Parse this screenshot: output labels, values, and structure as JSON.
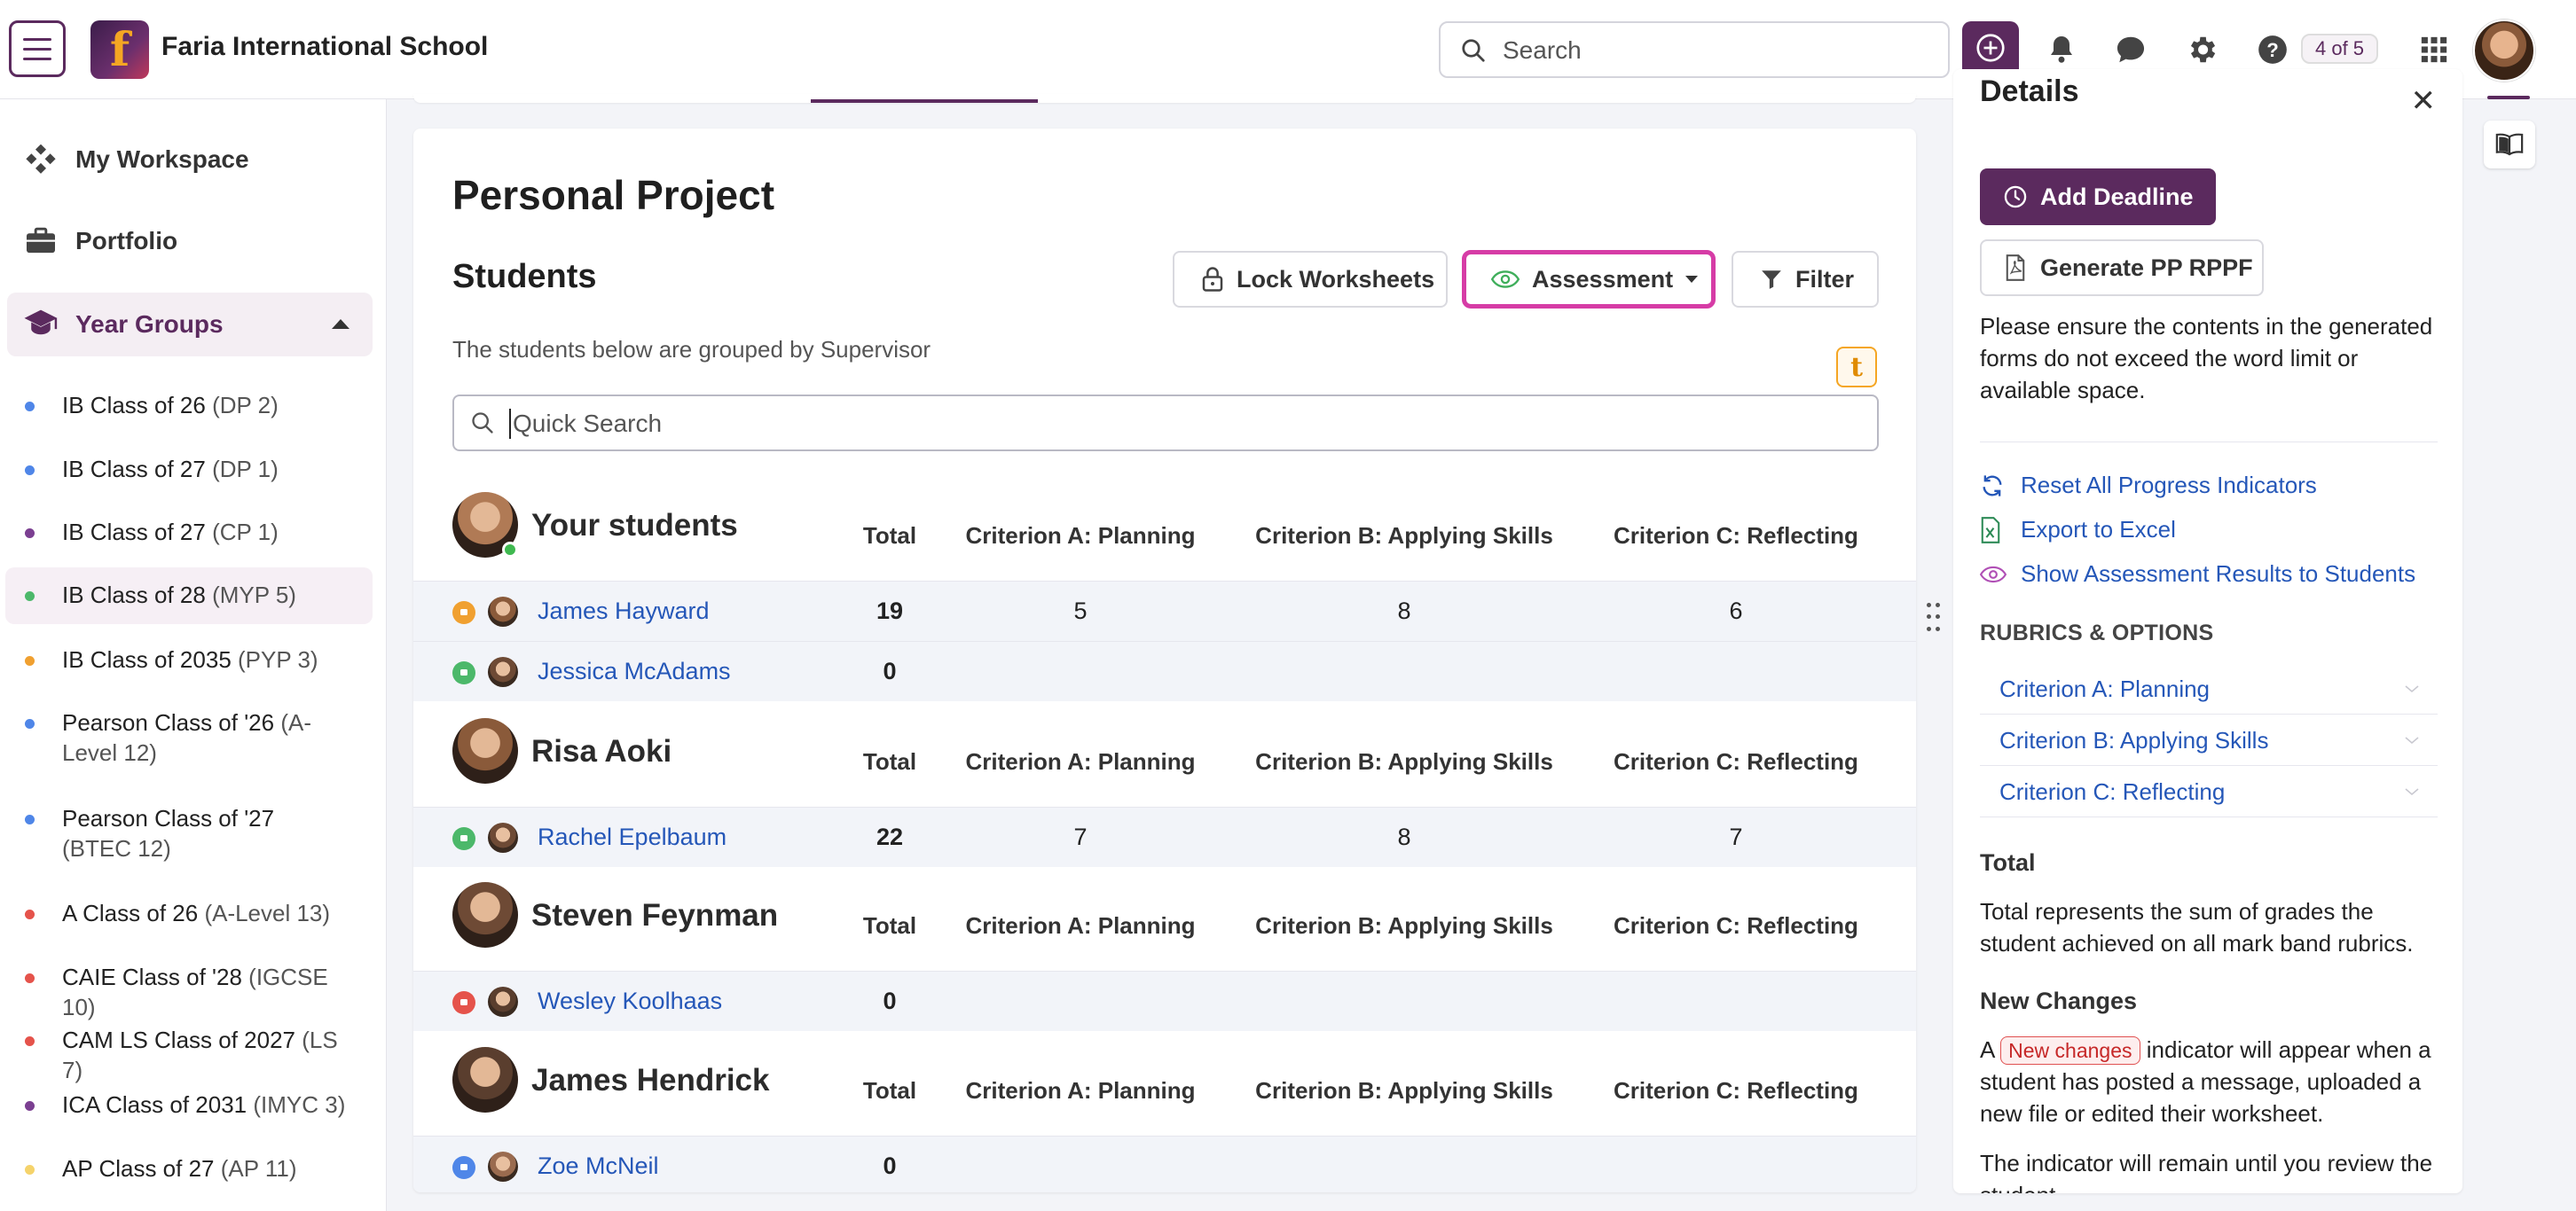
{
  "header": {
    "school_name": "Faria International School",
    "logo_letter": "f",
    "search_placeholder": "Search",
    "pager": "4 of 5",
    "icons": [
      "menu-icon",
      "plus-circle-icon",
      "bell-icon",
      "chat-icon",
      "gear-icon",
      "help-icon",
      "apps-grid-icon"
    ]
  },
  "sidebar": {
    "my_workspace": "My Workspace",
    "portfolio": "Portfolio",
    "year_groups": "Year Groups",
    "classes": [
      {
        "name": "IB Class of 26",
        "abbr": "(DP 2)",
        "color": "#4f86e8",
        "active": false
      },
      {
        "name": "IB Class of 27",
        "abbr": "(DP 1)",
        "color": "#4f86e8",
        "active": false
      },
      {
        "name": "IB Class of 27",
        "abbr": "(CP 1)",
        "color": "#7b3f91",
        "active": false
      },
      {
        "name": "IB Class of 28",
        "abbr": "(MYP 5)",
        "color": "#4cb86a",
        "active": true
      },
      {
        "name": "IB Class of 2035",
        "abbr": "(PYP 3)",
        "color": "#f0a030",
        "active": false
      },
      {
        "name": "Pearson Class of '26",
        "abbr": "(A-Level 12)",
        "color": "#4f86e8",
        "active": false
      },
      {
        "name": "Pearson Class of '27",
        "abbr": "(BTEC 12)",
        "color": "#4f86e8",
        "active": false
      },
      {
        "name": "A Class of 26",
        "abbr": "(A-Level 13)",
        "color": "#e5534b",
        "active": false
      },
      {
        "name": "CAIE Class of '28",
        "abbr": "(IGCSE 10)",
        "color": "#e5534b",
        "active": false
      },
      {
        "name": "CAM LS Class of 2027",
        "abbr": "(LS 7)",
        "color": "#e5534b",
        "active": false
      },
      {
        "name": "ICA Class of 2031",
        "abbr": "(IMYC 3)",
        "color": "#7b3f91",
        "active": false
      },
      {
        "name": "AP Class of 27",
        "abbr": "(AP 11)",
        "color": "#f5d36b",
        "active": false
      }
    ]
  },
  "main": {
    "page_title": "Personal Project",
    "students_title": "Students",
    "buttons": {
      "lock": "Lock Worksheets",
      "assessment": "Assessment",
      "filter": "Filter"
    },
    "grouped_note": "The students below are grouped by Supervisor",
    "t_badge": "t",
    "quick_search_placeholder": "Quick Search",
    "columns": [
      "Total",
      "Criterion A: Planning",
      "Criterion B: Applying Skills",
      "Criterion C: Reflecting"
    ],
    "groups": [
      {
        "supervisor": "Your students",
        "online": true,
        "students": [
          {
            "name": "James Hayward",
            "status": "orange",
            "total": "19",
            "a": "5",
            "b": "8",
            "c": "6"
          },
          {
            "name": "Jessica McAdams",
            "status": "green",
            "total": "0",
            "a": "",
            "b": "",
            "c": ""
          }
        ]
      },
      {
        "supervisor": "Risa Aoki",
        "online": false,
        "students": [
          {
            "name": "Rachel Epelbaum",
            "status": "green",
            "total": "22",
            "a": "7",
            "b": "8",
            "c": "7"
          }
        ]
      },
      {
        "supervisor": "Steven Feynman",
        "online": false,
        "students": [
          {
            "name": "Wesley Koolhaas",
            "status": "red",
            "total": "0",
            "a": "",
            "b": "",
            "c": ""
          }
        ]
      },
      {
        "supervisor": "James Hendrick",
        "online": false,
        "students": [
          {
            "name": "Zoe McNeil",
            "status": "blue",
            "total": "0",
            "a": "",
            "b": "",
            "c": ""
          }
        ]
      }
    ]
  },
  "details": {
    "title": "Details",
    "add_deadline": "Add Deadline",
    "generate": "Generate PP RPPF",
    "ensure_text": "Please ensure the contents in the generated forms do not exceed the word limit or available space.",
    "links": {
      "reset": "Reset All Progress Indicators",
      "export": "Export to Excel",
      "show": "Show Assessment Results to Students"
    },
    "rubrics_heading": "RUBRICS & OPTIONS",
    "rubrics": [
      "Criterion A: Planning",
      "Criterion B: Applying Skills",
      "Criterion C: Reflecting"
    ],
    "total_heading": "Total",
    "total_text": "Total represents the sum of grades the student achieved on all mark band rubrics.",
    "new_changes_heading": "New Changes",
    "new_changes_pre": "A",
    "new_changes_tag": "New changes",
    "new_changes_post": "indicator will appear when a student has posted a message, uploaded a new file or edited their worksheet.",
    "remain_text": "The indicator will remain until you review the student"
  },
  "colors": {
    "brand": "#5b2a5e",
    "link": "#2557b8",
    "highlight": "#d63ca6"
  }
}
